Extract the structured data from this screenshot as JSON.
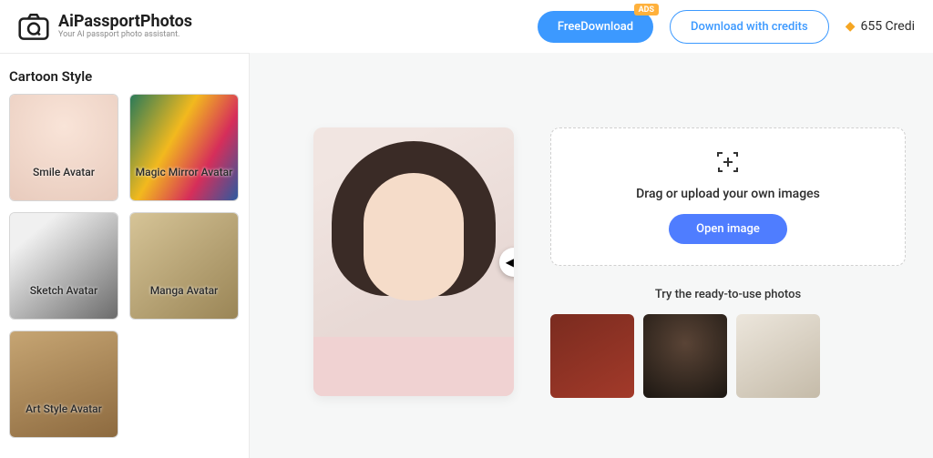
{
  "header": {
    "brand_title": "AiPassportPhotos",
    "brand_subtitle": "Your AI passport photo assistant.",
    "free_download_label": "FreeDownload",
    "ads_badge": "ADS",
    "download_credits_label": "Download with credits",
    "credits_text": "655 Credi"
  },
  "sidebar": {
    "title": "Cartoon Style",
    "styles": [
      {
        "label": "Smile Avatar"
      },
      {
        "label": "Magic Mirror Avatar"
      },
      {
        "label": "Sketch Avatar"
      },
      {
        "label": "Manga Avatar"
      },
      {
        "label": "Art Style Avatar"
      }
    ]
  },
  "main": {
    "dropzone": {
      "text": "Drag or upload your own images",
      "button_label": "Open image"
    },
    "samples_title": "Try the ready-to-use photos"
  }
}
